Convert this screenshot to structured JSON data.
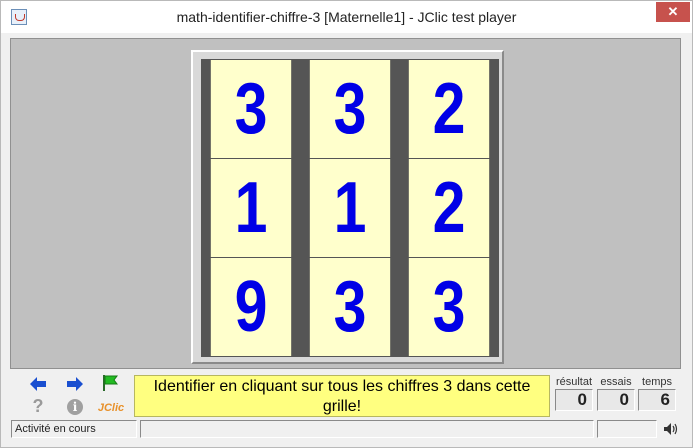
{
  "window": {
    "title": "math-identifier-chiffre-3 [Maternelle1] - JClic test player",
    "close_label": "✕"
  },
  "grid": {
    "cells": [
      "3",
      "3",
      "2",
      "1",
      "1",
      "2",
      "9",
      "3",
      "3"
    ],
    "digit_color": "#0000e6",
    "cell_background": "#ffffcc"
  },
  "toolbar": {
    "prev_icon": "arrow-left-icon",
    "next_icon": "arrow-right-icon",
    "restart_icon": "green-flag-icon",
    "help_label": "?",
    "info_label": "i",
    "jclic_label": "JClic"
  },
  "message": {
    "text": "Identifier en cliquant sur tous les chiffres 3 dans cette grille!"
  },
  "counters": {
    "result_label": "résultat",
    "result_value": "0",
    "tries_label": "essais",
    "tries_value": "0",
    "time_label": "temps",
    "time_value": "6"
  },
  "status": {
    "text": "Activité en cours"
  }
}
